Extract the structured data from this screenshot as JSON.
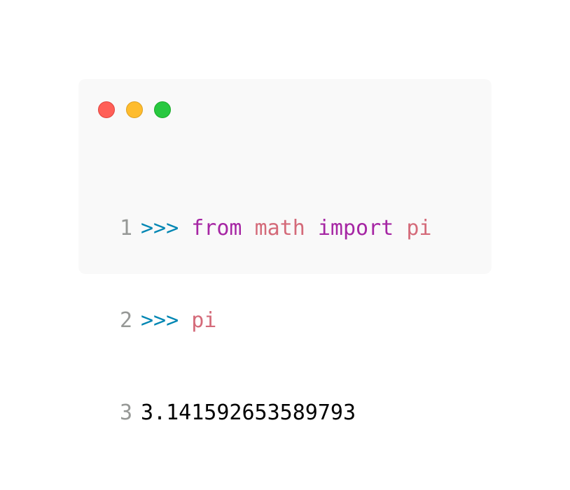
{
  "colors": {
    "window_bg": "#f9f9f9",
    "close_dot": "#ff5f57",
    "minimize_dot": "#febc2e",
    "zoom_dot": "#28c840",
    "line_number": "#969896",
    "prompt": "#0086b3",
    "keyword": "#a626a4",
    "identifier": "#d46a79",
    "output": "#000000"
  },
  "window_controls": {
    "close": "red-dot",
    "minimize": "yellow-dot",
    "zoom": "green-dot"
  },
  "code": {
    "lines": [
      {
        "number": "1",
        "prompt": ">>>",
        "tokens": [
          "from",
          "math",
          "import",
          "pi"
        ]
      },
      {
        "number": "2",
        "prompt": ">>>",
        "tokens": [
          "pi"
        ]
      },
      {
        "number": "3",
        "output": "3.141592653589793"
      }
    ]
  }
}
